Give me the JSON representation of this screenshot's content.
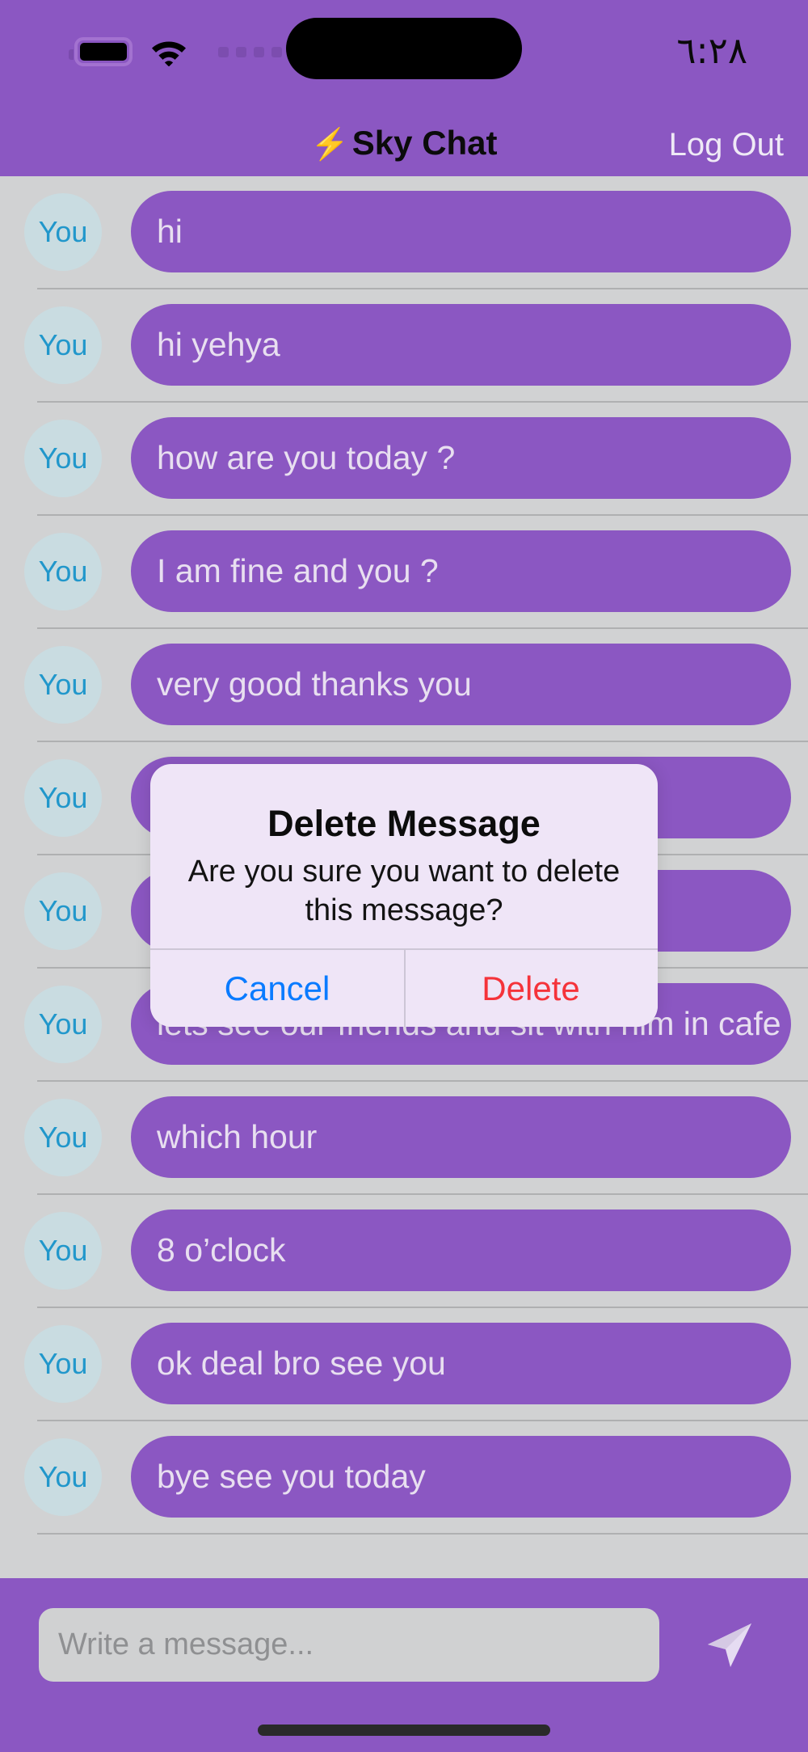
{
  "status_bar": {
    "time": "٦:٢٨",
    "battery_icon": "battery-icon",
    "wifi_icon": "wifi-icon",
    "signal_dots_icon": "signal-dots-icon"
  },
  "app_bar": {
    "title_icon": "⚡",
    "title": "Sky Chat",
    "logout_label": "Log Out"
  },
  "chat": {
    "sender_label": "You",
    "messages": [
      {
        "sender": "You",
        "text": "hi"
      },
      {
        "sender": "You",
        "text": "hi yehya"
      },
      {
        "sender": "You",
        "text": "how are you today ?"
      },
      {
        "sender": "You",
        "text": "I am fine and you ?"
      },
      {
        "sender": "You",
        "text": "very good thanks you"
      },
      {
        "sender": "You",
        "text": ""
      },
      {
        "sender": "You",
        "text": ""
      },
      {
        "sender": "You",
        "text": "lets see our friends and sit with him in cafe"
      },
      {
        "sender": "You",
        "text": "which hour"
      },
      {
        "sender": "You",
        "text": "8 o’clock"
      },
      {
        "sender": "You",
        "text": "ok deal bro see you"
      },
      {
        "sender": "You",
        "text": "bye see you today"
      }
    ]
  },
  "composer": {
    "placeholder": "Write a message...",
    "value": "",
    "send_icon": "send-icon"
  },
  "alert": {
    "title": "Delete Message",
    "message": "Are you sure you want to delete this message?",
    "cancel_label": "Cancel",
    "delete_label": "Delete"
  },
  "colors": {
    "accent_purple": "#8B57C2",
    "chat_background": "#D1D2D3",
    "avatar_background": "#C9DCE1",
    "avatar_text": "#2197CB",
    "bubble_text": "#E8DFF0",
    "alert_background": "#EFE5F7",
    "cancel_blue": "#0A7BFF",
    "delete_red": "#F5333A"
  }
}
